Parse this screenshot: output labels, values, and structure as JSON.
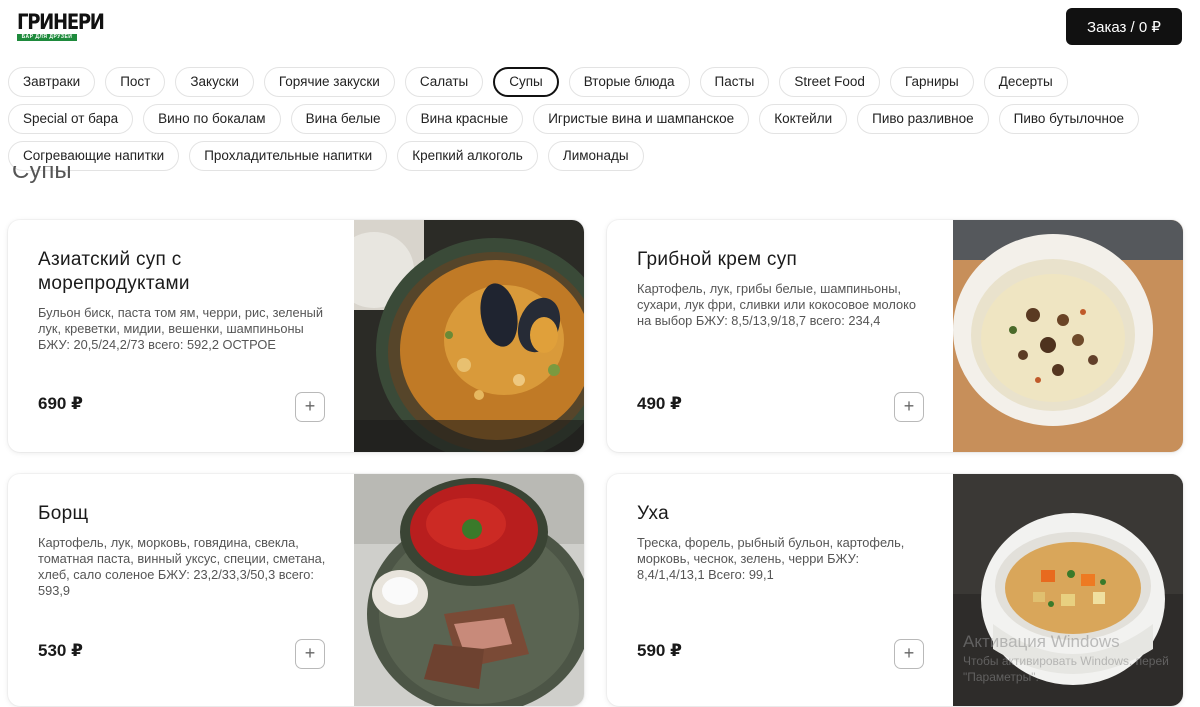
{
  "header": {
    "logo_text": "ГРИНЕРИ",
    "logo_sub": "БАР ДЛЯ ДРУЗЕЙ",
    "order_button": "Заказ / 0 ₽"
  },
  "categories": {
    "row1": [
      "Завтраки",
      "Пост",
      "Закуски",
      "Горячие закуски",
      "Салаты",
      "Супы",
      "Вторые блюда",
      "Пасты",
      "Street Food",
      "Гарниры",
      "Десерты"
    ],
    "row2": [
      "Special от бара",
      "Вино по бокалам",
      "Вина белые",
      "Вина красные",
      "Игристые вина и шампанское",
      "Коктейли",
      "Пиво разливное",
      "Пиво бутылочное"
    ],
    "row3": [
      "Согревающие напитки",
      "Прохладительные напитки",
      "Крепкий алкоголь",
      "Лимонады"
    ],
    "active": "Супы"
  },
  "section_title": "Супы",
  "dishes": [
    {
      "title": "Азиатский суп с морепродуктами",
      "description": "Бульон биск, паста том ям, черри, рис, зеленый лук, креветки, мидии, вешенки, шампиньоны БЖУ: 20,5/24,2/73 всего: 592,2 ОСТРОЕ",
      "price": "690 ₽",
      "add_label": "+"
    },
    {
      "title": "Грибной крем суп",
      "description": "Картофель, лук, грибы белые, шампиньоны, сухари, лук фри, сливки или кокосовое молоко на выбор БЖУ: 8,5/13,9/18,7 всего: 234,4",
      "price": "490 ₽",
      "add_label": "+"
    },
    {
      "title": "Борщ",
      "description": "Картофель, лук, морковь, говядина, свекла, томатная паста, винный уксус, специи, сметана, хлеб, сало соленое БЖУ: 23,2/33,3/50,3 всего: 593,9",
      "price": "530 ₽",
      "add_label": "+"
    },
    {
      "title": "Уха",
      "description": "Треска, форель, рыбный бульон, картофель, морковь, чеснок, зелень, черри БЖУ: 8,4/1,4/13,1 Всего: 99,1",
      "price": "590 ₽",
      "add_label": "+"
    }
  ],
  "watermark": {
    "line1": "Активация Windows",
    "line2": "Чтобы активировать Windows, перей",
    "line3": "\"Параметры\"."
  },
  "colors": {
    "accent": "#111111",
    "logo_green": "#1e8a3c",
    "chip_border": "#e3e3e3"
  },
  "icons": [
    "plus-icon"
  ]
}
